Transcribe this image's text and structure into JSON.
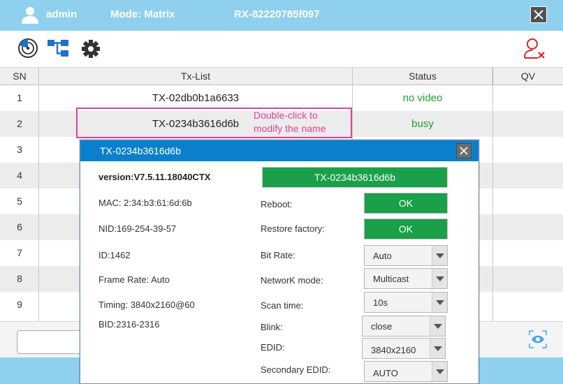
{
  "header": {
    "user": "admin",
    "mode": "Mode: Matrix",
    "device_id": "RX-82220785f097"
  },
  "table": {
    "headers": {
      "sn": "SN",
      "tx": "Tx-List",
      "status": "Status",
      "qv": "QV"
    },
    "rows": [
      {
        "sn": "1",
        "tx": "TX-02db0b1a6633",
        "status": "no video"
      },
      {
        "sn": "2",
        "tx": "TX-0234b3616d6b",
        "status": "busy"
      },
      {
        "sn": "3",
        "tx": "",
        "status": ""
      },
      {
        "sn": "4",
        "tx": "",
        "status": ""
      },
      {
        "sn": "5",
        "tx": "",
        "status": ""
      },
      {
        "sn": "6",
        "tx": "",
        "status": ""
      },
      {
        "sn": "7",
        "tx": "",
        "status": ""
      },
      {
        "sn": "8",
        "tx": "",
        "status": ""
      },
      {
        "sn": "9",
        "tx": "",
        "status": ""
      }
    ]
  },
  "hint": {
    "line1": "Double-click to",
    "line2": "modify the name"
  },
  "dialog": {
    "title": "TX-0234b3616d6b",
    "version": "version:V7.5.11.18040CTX",
    "name_value": "TX-0234b3616d6b",
    "mac": "MAC: 2:34:b3:61:6d:6b",
    "nid": "NID:169-254-39-57",
    "id": "ID:1462",
    "frame_rate": "Frame Rate: Auto",
    "timing": "Timing: 3840x2160@60",
    "bid": "BID:2316-2316",
    "reboot_label": "Reboot:",
    "reboot_btn": "OK",
    "restore_label": "Restore factory:",
    "restore_btn": "OK",
    "bitrate_label": "Bit Rate:",
    "bitrate_value": "Auto",
    "network_label": "NetworK mode:",
    "network_value": "Multicast",
    "scan_label": "Scan time:",
    "scan_value": "10s",
    "blink_label": "Blink:",
    "blink_value": "close",
    "edid_label": "EDID:",
    "edid_value": "3840x2160",
    "secondary_edid_label": "Secondary EDID:",
    "secondary_edid_value": "AUTO"
  },
  "colors": {
    "header_bg": "#8ed0ee",
    "dialog_title_bg": "#0a80cc",
    "ok_green": "#1aa049",
    "status_green": "#1f9e2e",
    "hint_pink": "#e0409a"
  }
}
